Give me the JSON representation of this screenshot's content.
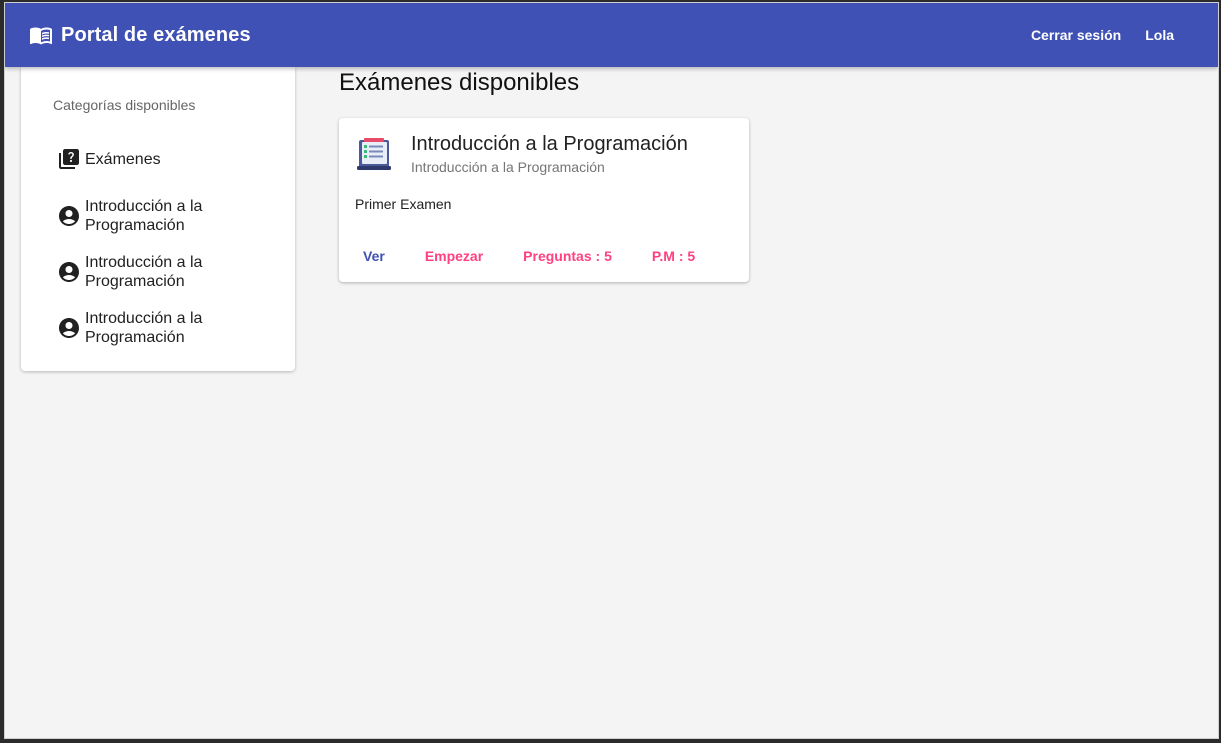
{
  "toolbar": {
    "title": "Portal de exámenes",
    "logout_label": "Cerrar sesión",
    "user_label": "Lola",
    "brand_color": "#3f51b5",
    "brand_icon": "menu-book-icon"
  },
  "sidebar": {
    "subheader": "Categorías disponibles",
    "items": [
      {
        "label": "Exámenes",
        "icon": "quiz-icon"
      },
      {
        "label": "Introducción a la Programación",
        "icon": "account-circle-icon"
      },
      {
        "label": "Introducción a la Programación",
        "icon": "account-circle-icon"
      },
      {
        "label": "Introducción a la Programación",
        "icon": "account-circle-icon"
      }
    ]
  },
  "main": {
    "title": "Exámenes disponibles",
    "exams": [
      {
        "title": "Introducción a la Programación",
        "subtitle": "Introducción a la Programación",
        "description": "Primer Examen",
        "avatar": "exam-document-icon",
        "actions": {
          "view": "Ver",
          "start": "Empezar",
          "questions": "Preguntas : 5",
          "max_points": "P.M : 5"
        }
      }
    ]
  },
  "colors": {
    "primary": "#3f51b5",
    "accent": "#ff4081",
    "background": "#f4f4f4"
  }
}
